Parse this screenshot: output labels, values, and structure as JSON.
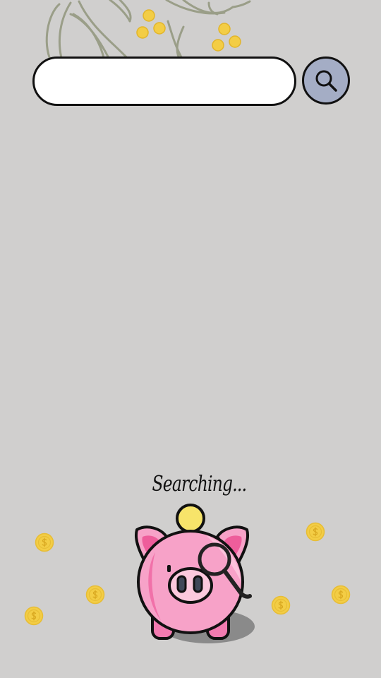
{
  "search": {
    "value": "",
    "placeholder": ""
  },
  "status": {
    "text": "Searching..."
  },
  "icons": {
    "search_button": "search-icon",
    "mascot": "piggy-bank-icon",
    "coins": "coin-icon",
    "decor": "leaf-plant-icon"
  },
  "colors": {
    "background": "#d0cfce",
    "search_button": "#a4adc5",
    "pig_body": "#f7a2c8",
    "pig_outline": "#111111",
    "coin": "#f3cd45"
  }
}
